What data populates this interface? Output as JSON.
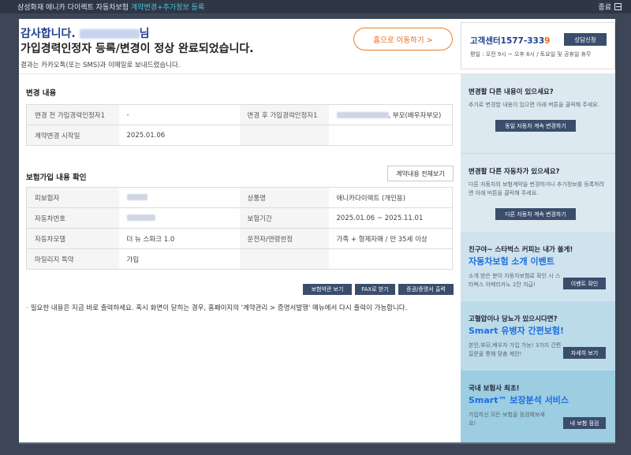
{
  "topbar": {
    "title_prefix": "삼성화재 애니카 다이렉트 자동차보험",
    "title_accent": "계약변경+추가정보 등록",
    "close_label": "종료"
  },
  "hero": {
    "thanks_prefix": "감사합니다.",
    "thanks_suffix": "님",
    "headline": "가입경력인정자 등록/변경이 정상 완료되었습니다.",
    "sub": "결과는 카카오톡(또는 SMS)과 이메일로 보내드렸습니다.",
    "home_button": "홈으로 이동하기 >"
  },
  "customer_service": {
    "label": "고객센터",
    "number_main": "1577-333",
    "number_last": "9",
    "hours": "평일 : 오전 9시 ~ 오후 6시 / 토요일 및 공휴일 휴무",
    "consult_button": "상담신청"
  },
  "change": {
    "title": "변경 내용",
    "rows": [
      {
        "label1": "변경 전 가입경력인정자1",
        "value1": "-",
        "label2": "변경 후 가입경력인정자1",
        "value2_suffix": ", 부모(배우자부모)"
      },
      {
        "label1": "계약변경 시작일",
        "value1": "2025.01.06",
        "label2": "",
        "value2_suffix": ""
      }
    ]
  },
  "insurance": {
    "title": "보험가입 내용 확인",
    "view_all_button": "계약내용 전체보기",
    "rows": [
      {
        "label1": "피보험자",
        "value1": "",
        "label2": "상품명",
        "value2": "애니카다이렉트 (개인용)"
      },
      {
        "label1": "자동차번호",
        "value1": "",
        "label2": "보험기간",
        "value2": "2025.01.06 ~ 2025.11.01"
      },
      {
        "label1": "자동차모델",
        "value1": "더 뉴 스파크 1.0",
        "label2": "운전자/연령한정",
        "value2": "가족 + 형제자매 / 만 35세 이상"
      },
      {
        "label1": "마일리지 특약",
        "value1": "가입",
        "label2": "",
        "value2": ""
      }
    ],
    "buttons": [
      "보험약관 보기",
      "FAX로 받기",
      "증권/증명서 출력"
    ]
  },
  "notice": "필요한 내용은 지금 바로 출력하세요. 혹시 화면이 닫히는 경우, 홈페이지의 '계약관리 > 증명서발행' 메뉴에서 다시 출력이 가능합니다.",
  "side": {
    "p1": {
      "title": "변경할 다른 내용이 있으세요?",
      "desc": "추가로 변경할 내용이 있으면 아래 버튼을 클릭해 주세요.",
      "button": "동일 자동차 계속 변경하기"
    },
    "p2": {
      "title": "변경할 다른 자동차가 있으세요?",
      "desc": "다른 자동차의 보험계약을 변경하거나 추가정보를 등록하려면 아래 버튼을 클릭해 주세요.",
      "button": "다른 자동차 계속 변경하기"
    },
    "p3": {
      "title": "친구야~ 스타벅스 커피는 내가 쏠게!",
      "big": "자동차보험 소개 이벤트",
      "desc": "소개 받은 분이 자동차보험료 확인 시 스타벅스 아메리카노 2잔 지급!",
      "button": "이벤트 확인"
    },
    "p4": {
      "title": "고혈압이나 당뇨가 있으시다면?",
      "big": "Smart 유병자 간편보험!",
      "desc": "본인,부모,배우자 가입 가능! 3가지 간편 질문을 통해 맞춤 제안!",
      "button": "자세히 보기"
    },
    "p5": {
      "title": "국내 보험사 최초!",
      "big": "Smart™ 보장분석 서비스",
      "desc": "가입하신 모든 보험을 점검해보세요!",
      "button": "내 보험 점검"
    }
  }
}
